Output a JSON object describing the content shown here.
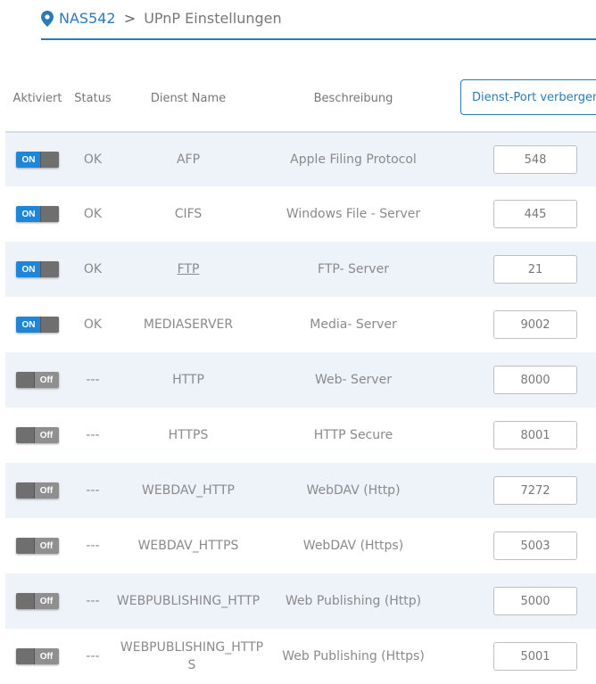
{
  "breadcrumb": {
    "root": "NAS542",
    "separator": ">",
    "current": "UPnP Einstellungen"
  },
  "table": {
    "headers": {
      "enabled": "Aktiviert",
      "status": "Status",
      "name": "Dienst Name",
      "description": "Beschreibung"
    },
    "hide_port_button": "Dienst-Port verbergen",
    "toggle_on": "ON",
    "toggle_off": "Off",
    "rows": [
      {
        "enabled": true,
        "status": "OK",
        "name": "AFP",
        "description": "Apple Filing Protocol",
        "port": "548"
      },
      {
        "enabled": true,
        "status": "OK",
        "name": "CIFS",
        "description": "Windows File - Server",
        "port": "445"
      },
      {
        "enabled": true,
        "status": "OK",
        "name": "FTP",
        "description": "FTP- Server",
        "port": "21"
      },
      {
        "enabled": true,
        "status": "OK",
        "name": "MEDIASERVER",
        "description": "Media- Server",
        "port": "9002"
      },
      {
        "enabled": false,
        "status": "---",
        "name": "HTTP",
        "description": "Web- Server",
        "port": "8000"
      },
      {
        "enabled": false,
        "status": "---",
        "name": "HTTPS",
        "description": "HTTP Secure",
        "port": "8001"
      },
      {
        "enabled": false,
        "status": "---",
        "name": "WEBDAV_HTTP",
        "description": "WebDAV (Http)",
        "port": "7272"
      },
      {
        "enabled": false,
        "status": "---",
        "name": "WEBDAV_HTTPS",
        "description": "WebDAV (Https)",
        "port": "5003"
      },
      {
        "enabled": false,
        "status": "---",
        "name": "WEBPUBLISHING_HTTP",
        "description": "Web Publishing (Http)",
        "port": "5000"
      },
      {
        "enabled": false,
        "status": "---",
        "name": "WEBPUBLISHING_HTTPS",
        "description": "Web Publishing (Https)",
        "port": "5001"
      }
    ]
  },
  "colors": {
    "accent": "#2a7ab8",
    "toggle_on": "#1e86d8",
    "toggle_off": "#8f8f8f",
    "row_alt": "#eef3f9"
  },
  "icons": {
    "breadcrumb": "location-pin-icon"
  }
}
